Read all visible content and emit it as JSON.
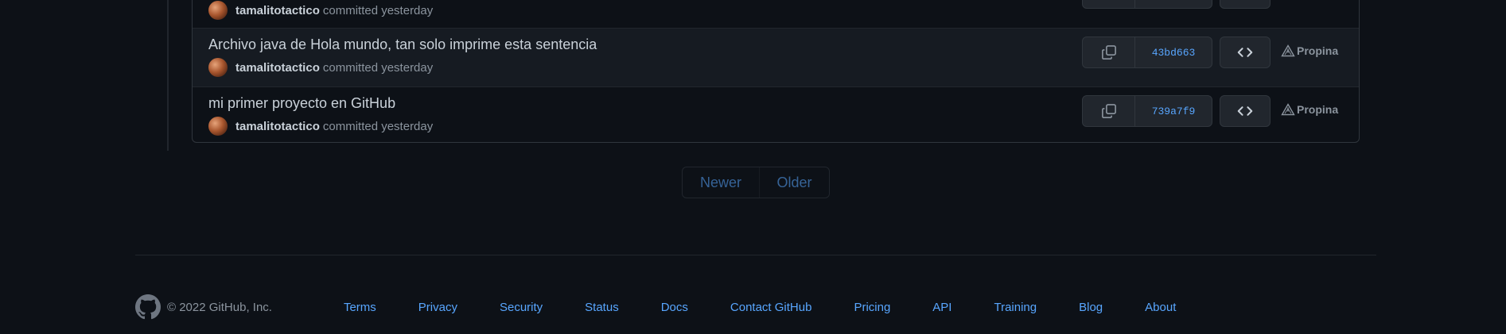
{
  "commits": [
    {
      "message": "",
      "author": "tamalitotactico",
      "committed_text": "committed yesterday",
      "sha": "",
      "badge": ""
    },
    {
      "message": "Archivo java de Hola mundo, tan solo imprime esta sentencia",
      "author": "tamalitotactico",
      "committed_text": "committed yesterday",
      "sha": "43bd663",
      "badge": "Propina"
    },
    {
      "message": "mi primer proyecto en GitHub",
      "author": "tamalitotactico",
      "committed_text": "committed yesterday",
      "sha": "739a7f9",
      "badge": "Propina"
    }
  ],
  "pagination": {
    "newer": "Newer",
    "older": "Older"
  },
  "footer": {
    "copyright": "© 2022 GitHub, Inc.",
    "links": [
      "Terms",
      "Privacy",
      "Security",
      "Status",
      "Docs",
      "Contact GitHub",
      "Pricing",
      "API",
      "Training",
      "Blog",
      "About"
    ]
  },
  "icons": {
    "copy": "copy-icon",
    "browse": "code-icon",
    "badge": "alert-triangle-icon",
    "logo": "github-mark-icon"
  },
  "colors": {
    "background": "#0d1117",
    "link": "#58a6ff",
    "muted": "#8b949e",
    "text": "#c9d1d9",
    "border": "#30363d"
  }
}
